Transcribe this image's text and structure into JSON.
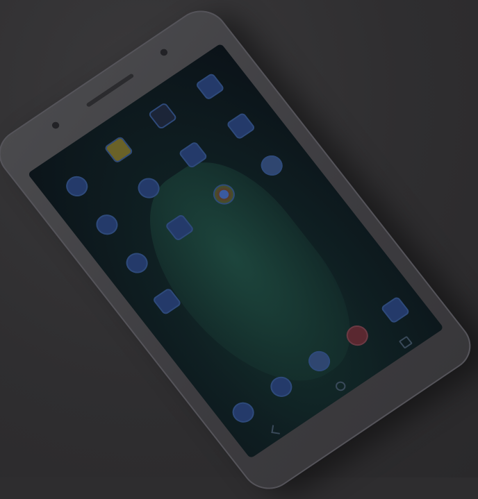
{
  "scene": {
    "description_free": true
  },
  "phone": {
    "screen": {
      "home_icons": [
        {
          "name": "app-icon-1",
          "shape": "circle",
          "color": "#243a6a"
        },
        {
          "name": "app-icon-2",
          "shape": "square",
          "color": "#6a6228"
        },
        {
          "name": "app-icon-3",
          "shape": "square",
          "color": "#1c2538"
        },
        {
          "name": "app-icon-4",
          "shape": "circle",
          "color": "#243a6a"
        },
        {
          "name": "app-icon-5",
          "shape": "square",
          "color": "#243a6a"
        },
        {
          "name": "app-icon-6",
          "shape": "circle",
          "color": "#243a6a"
        },
        {
          "name": "settings-icon",
          "shape": "circle",
          "color": "#2f4670"
        },
        {
          "name": "app-icon-8",
          "shape": "circle",
          "color": "#243a6a"
        },
        {
          "name": "app-icon-9",
          "shape": "circle",
          "color": "#243a6a"
        },
        {
          "name": "chrome-icon",
          "shape": "circle",
          "color": "#3a5aa0"
        },
        {
          "name": "app-icon-11",
          "shape": "square",
          "color": "#243a6a"
        },
        {
          "name": "app-icon-12",
          "shape": "square",
          "color": "#1c2538"
        }
      ],
      "dock_icons": [
        {
          "name": "phone-icon",
          "color": "#243a6a"
        },
        {
          "name": "messages-icon",
          "color": "#243a6a"
        },
        {
          "name": "apps-drawer-icon",
          "color": "#2f4670"
        },
        {
          "name": "contacts-icon",
          "color": "#5a2830"
        },
        {
          "name": "camera-icon",
          "color": "#243a6a"
        }
      ]
    }
  }
}
